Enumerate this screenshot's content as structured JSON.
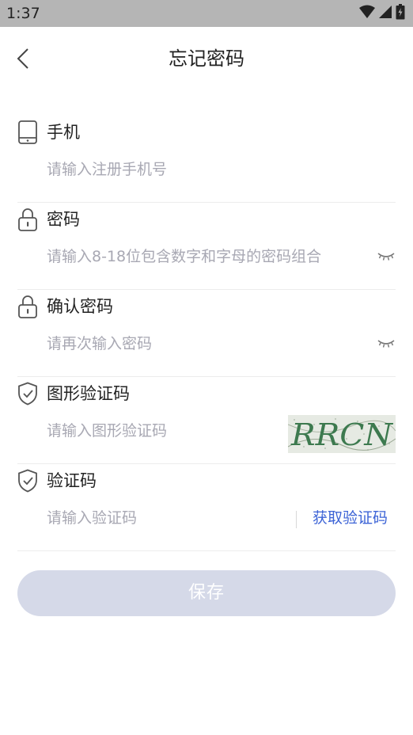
{
  "status_bar": {
    "time": "1:37",
    "icons": [
      "wifi-icon",
      "signal-icon",
      "battery-icon"
    ]
  },
  "header": {
    "title": "忘记密码",
    "back_icon": "back-arrow-icon"
  },
  "form": {
    "phone": {
      "label": "手机",
      "placeholder": "请输入注册手机号",
      "value": "",
      "icon": "phone-icon"
    },
    "password": {
      "label": "密码",
      "placeholder": "请输入8-18位包含数字和字母的密码组合",
      "value": "",
      "icon": "lock-icon",
      "toggle_icon": "eye-closed-icon"
    },
    "confirm_password": {
      "label": "确认密码",
      "placeholder": "请再次输入密码",
      "value": "",
      "icon": "lock-icon",
      "toggle_icon": "eye-closed-icon"
    },
    "captcha": {
      "label": "图形验证码",
      "placeholder": "请输入图形验证码",
      "value": "",
      "icon": "shield-check-icon",
      "image_text": "RRCN"
    },
    "sms_code": {
      "label": "验证码",
      "placeholder": "请输入验证码",
      "value": "",
      "icon": "shield-check-icon",
      "get_code_label": "获取验证码"
    }
  },
  "save_button": {
    "label": "保存"
  },
  "colors": {
    "status_bar": "#b5b5b5",
    "accent": "#3c63d6",
    "placeholder": "#a8a8b3",
    "button_disabled": "#d5d9e8",
    "divider": "#ececec"
  }
}
